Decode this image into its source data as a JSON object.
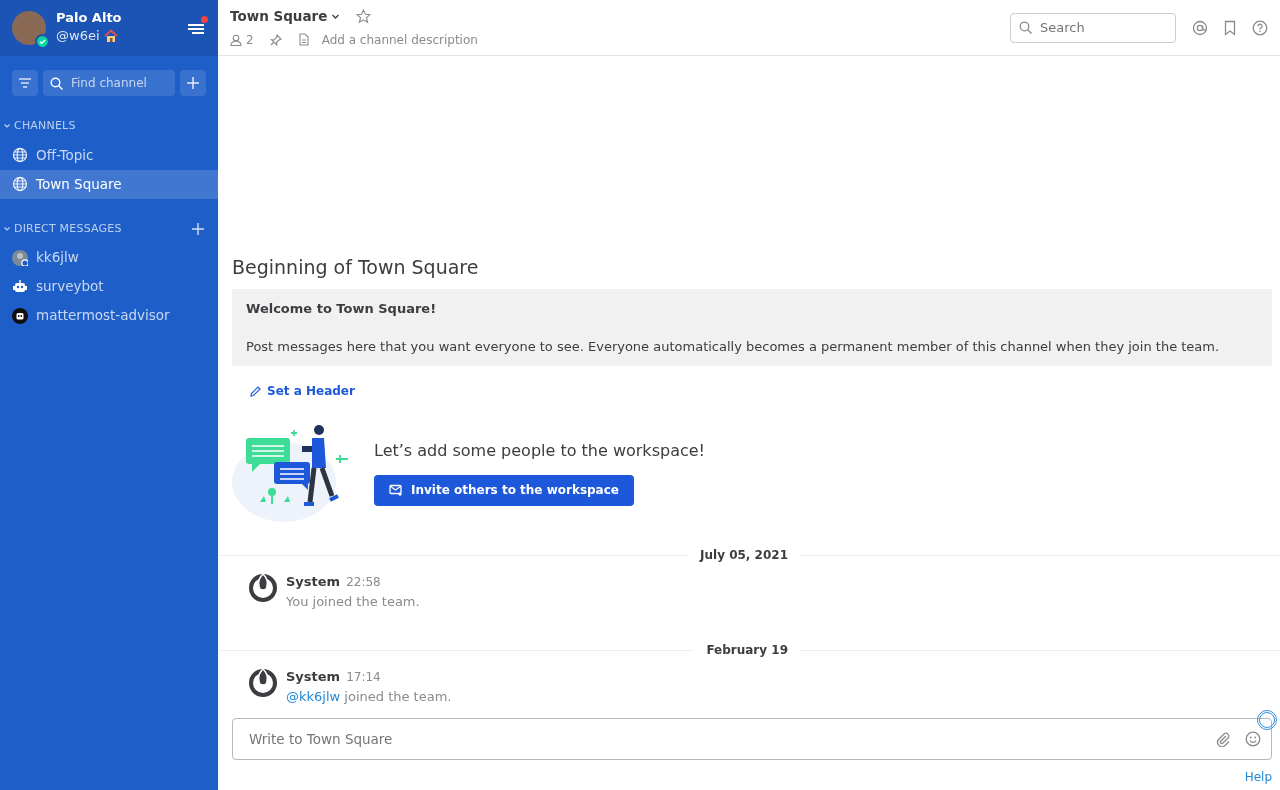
{
  "user": {
    "name": "Palo Alto",
    "handle": "@w6ei",
    "online": true,
    "has_unread": true
  },
  "sidebar": {
    "find_placeholder": "Find channel",
    "sections": [
      {
        "title": "CHANNELS",
        "expanded": true,
        "can_add": false,
        "items": [
          {
            "label": "Off-Topic",
            "kind": "public",
            "selected": false
          },
          {
            "label": "Town Square",
            "kind": "public",
            "selected": true
          }
        ]
      },
      {
        "title": "DIRECT MESSAGES",
        "expanded": true,
        "can_add": true,
        "items": [
          {
            "label": "kk6jlw",
            "kind": "user",
            "selected": false
          },
          {
            "label": "surveybot",
            "kind": "bot",
            "selected": false
          },
          {
            "label": "mattermost-advisor",
            "kind": "bot-dark",
            "selected": false
          }
        ]
      }
    ]
  },
  "header": {
    "channel_name": "Town Square",
    "favorited": false,
    "member_count": "2",
    "description_placeholder": "Add a channel description",
    "search_placeholder": "Search"
  },
  "intro": {
    "title": "Beginning of Town Square",
    "welcome_title": "Welcome to Town Square!",
    "welcome_text": "Post messages here that you want everyone to see. Everyone automatically becomes a permanent member of this channel when they join the team.",
    "set_header": "Set a Header",
    "invite_title": "Let’s add some people to the workspace!",
    "invite_button": "Invite others to the workspace"
  },
  "timeline": [
    {
      "kind": "date",
      "label": "July 05, 2021"
    },
    {
      "kind": "post",
      "author": "System",
      "time": "22:58",
      "text": "You joined the team."
    },
    {
      "kind": "date",
      "label": "February 19"
    },
    {
      "kind": "post",
      "author": "System",
      "time": "17:14",
      "mention": "@kk6jlw",
      "text": "joined the team."
    }
  ],
  "composer": {
    "placeholder": "Write to Town Square",
    "help": "Help"
  }
}
